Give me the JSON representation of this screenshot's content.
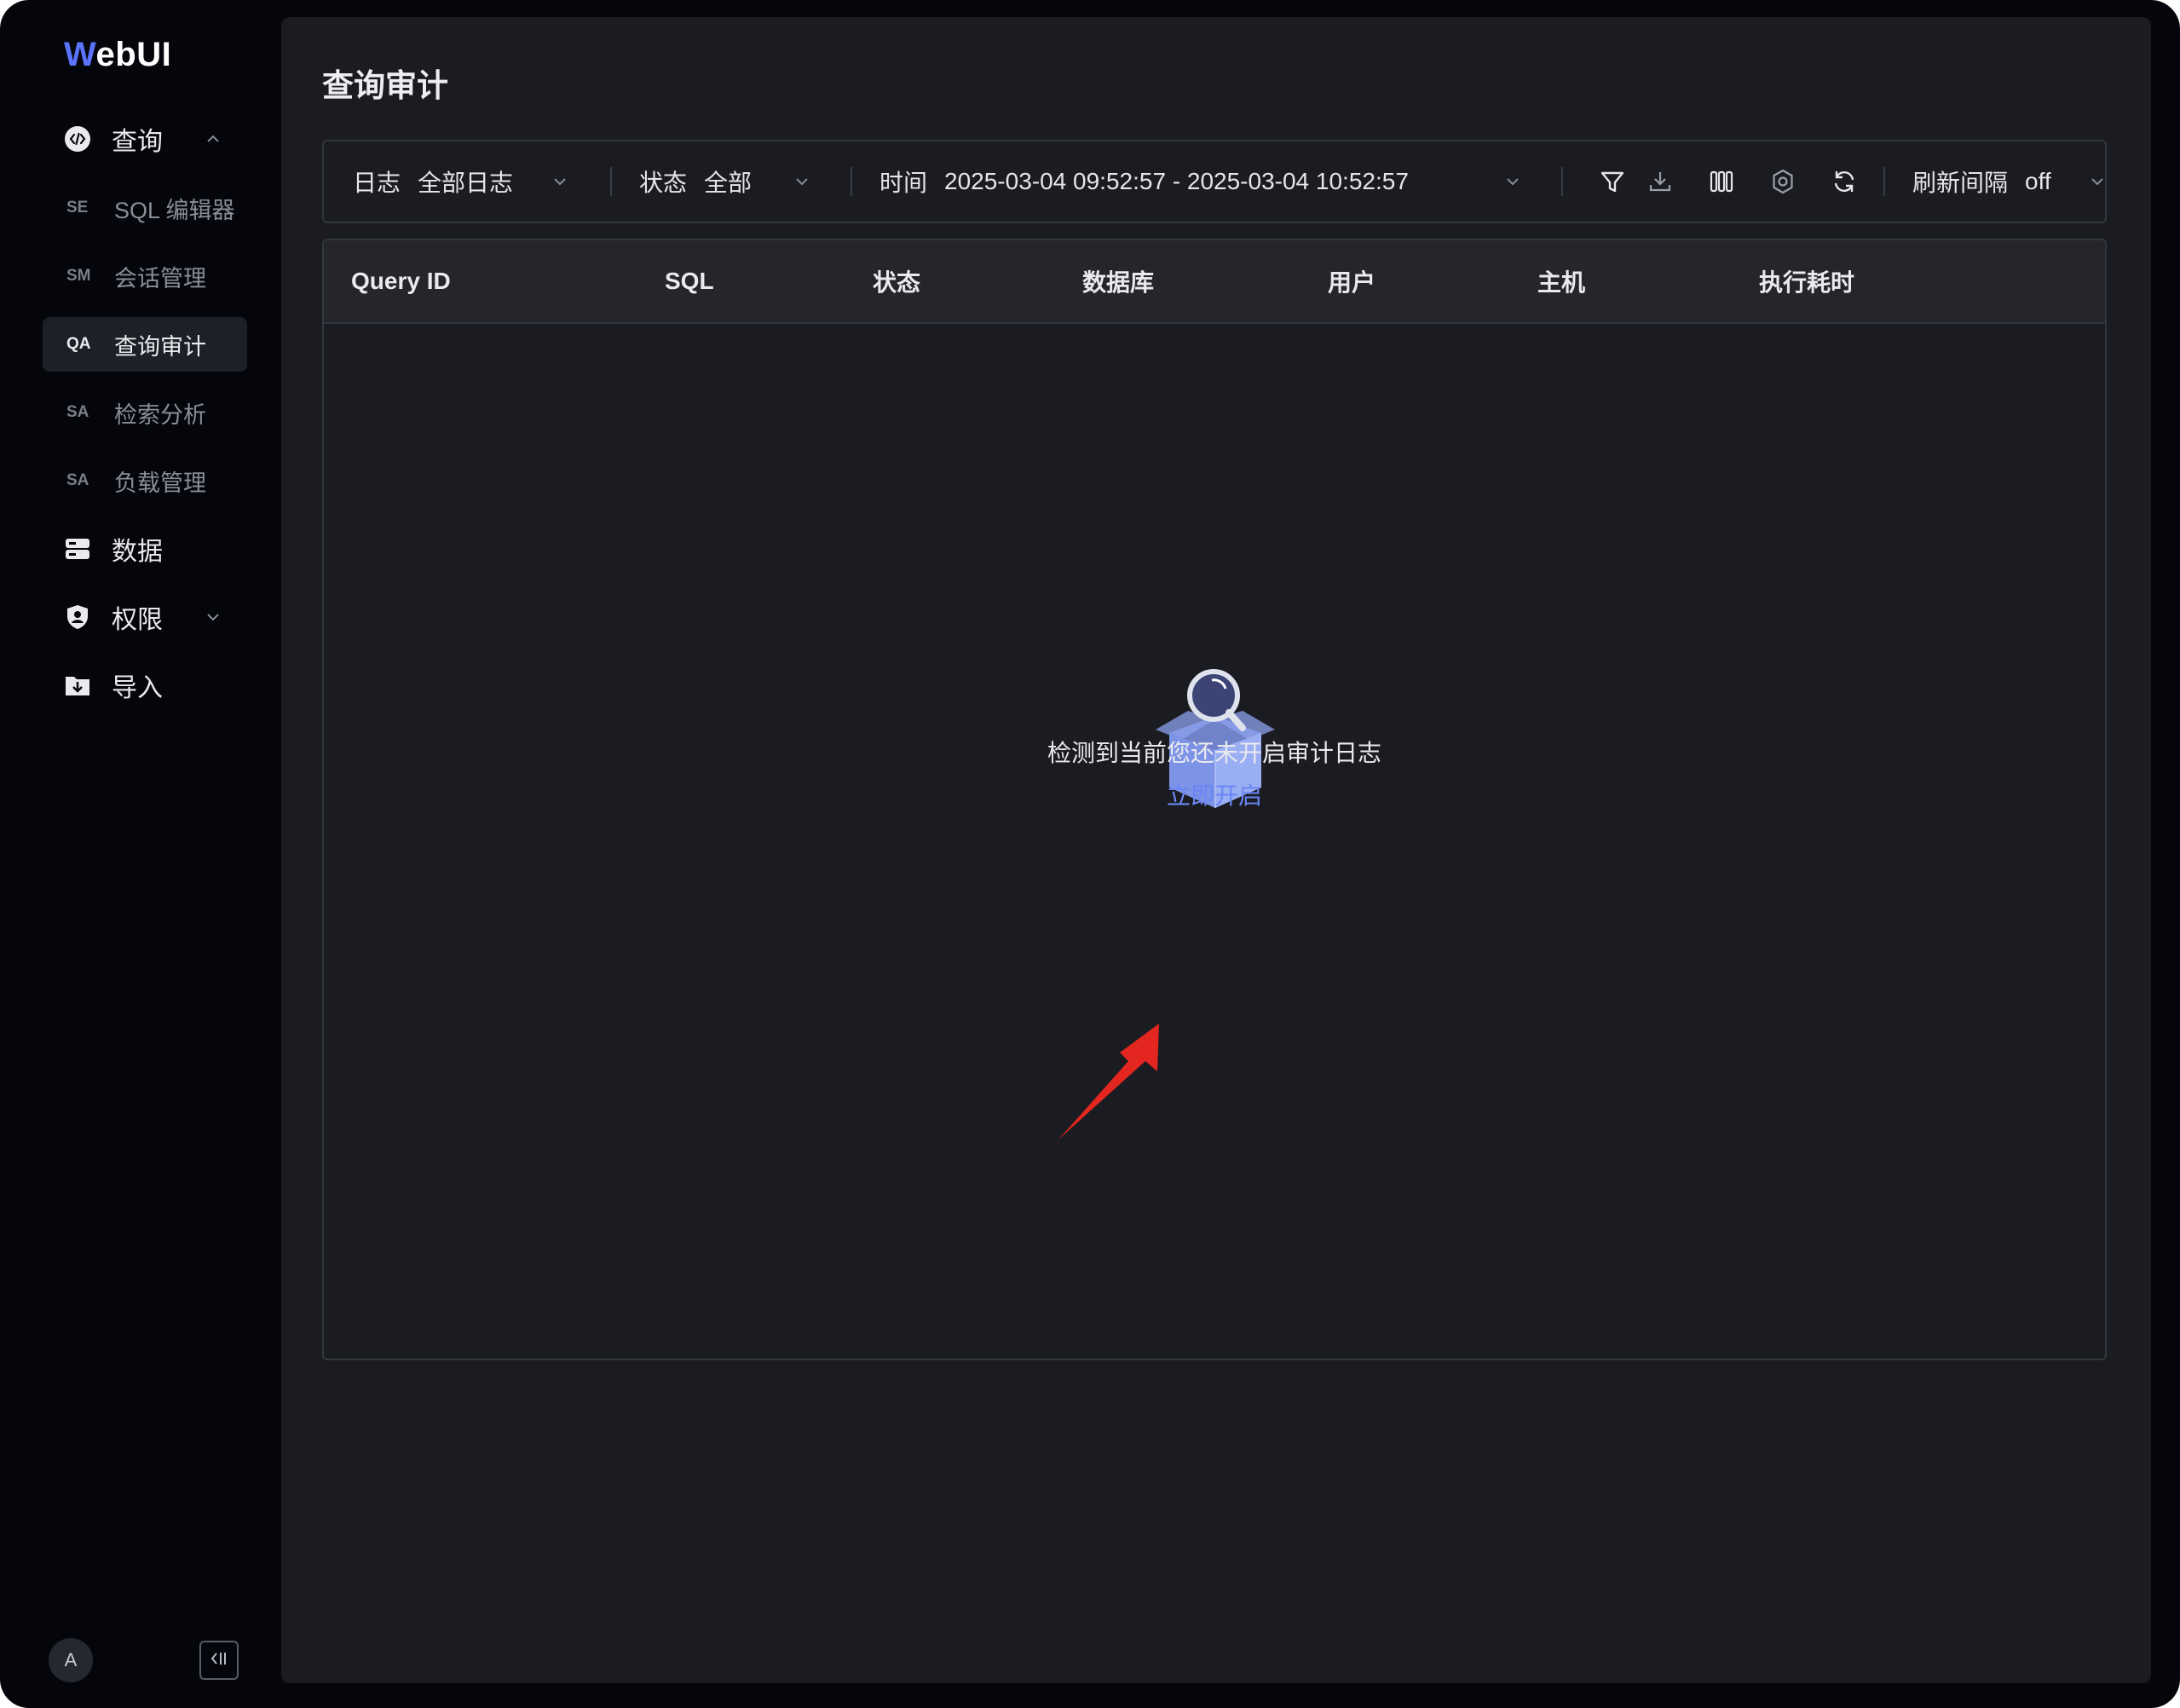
{
  "app": {
    "logo_letter": "W",
    "logo_rest": "ebUI"
  },
  "sidebar": {
    "groups": [
      {
        "label": "查询",
        "icon": "code-icon"
      },
      {
        "label": "数据",
        "icon": "database-icon"
      },
      {
        "label": "权限",
        "icon": "shield-icon"
      },
      {
        "label": "导入",
        "icon": "folder-import-icon"
      }
    ],
    "items": [
      {
        "abbr": "SE",
        "label": "SQL 编辑器"
      },
      {
        "abbr": "SM",
        "label": "会话管理"
      },
      {
        "abbr": "QA",
        "label": "查询审计"
      },
      {
        "abbr": "SA",
        "label": "检索分析"
      },
      {
        "abbr": "SA",
        "label": "负载管理"
      }
    ],
    "avatar": "A"
  },
  "page": {
    "title": "查询审计"
  },
  "toolbar": {
    "log_label": "日志",
    "log_value": "全部日志",
    "status_label": "状态",
    "status_value": "全部",
    "time_label": "时间",
    "time_value": "2025-03-04 09:52:57 - 2025-03-04 10:52:57",
    "refresh_label": "刷新间隔",
    "refresh_value": "off",
    "icons": [
      "filter-icon",
      "download-icon",
      "columns-icon",
      "settings-icon",
      "refresh-icon"
    ]
  },
  "table": {
    "columns": [
      "Query ID",
      "SQL",
      "状态",
      "数据库",
      "用户",
      "主机",
      "执行耗时"
    ]
  },
  "empty_state": {
    "message": "检测到当前您还未开启审计日志",
    "action": "立即开启"
  },
  "colors": {
    "accent": "#5b73ff",
    "link": "#6b86f5",
    "annotation_arrow": "#e3261f"
  }
}
